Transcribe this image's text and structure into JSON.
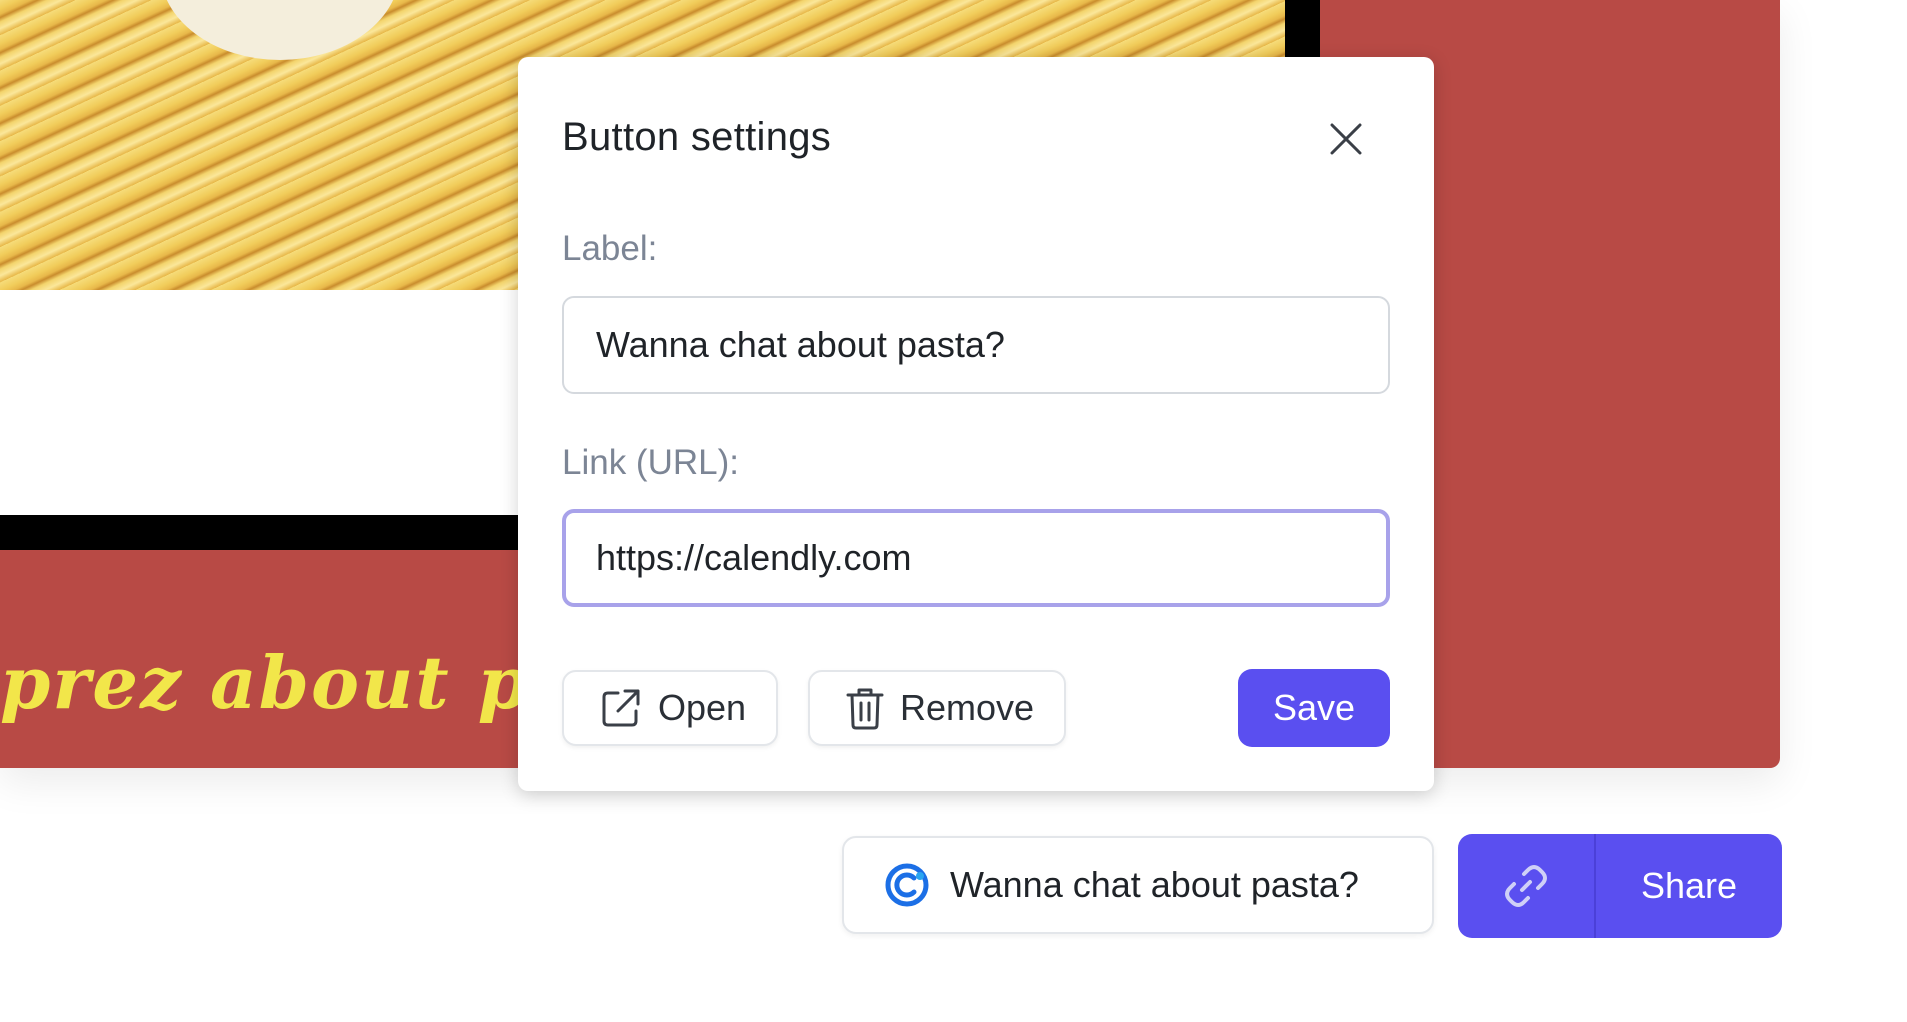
{
  "slide": {
    "text": "prez about p"
  },
  "modal": {
    "title": "Button settings",
    "label_field_label": "Label:",
    "label_value": "Wanna chat about pasta?",
    "link_field_label": "Link (URL):",
    "link_value": "https://calendly.com",
    "open_label": "Open",
    "remove_label": "Remove",
    "save_label": "Save"
  },
  "toolbar": {
    "cta_label": "Wanna chat about pasta?",
    "share_label": "Share"
  },
  "icons": {
    "close": "close-icon",
    "open": "external-link-icon",
    "remove": "trash-icon",
    "cta": "calendly-icon",
    "link": "link-icon"
  },
  "colors": {
    "accent": "#5a4ff0",
    "slide_background": "#b84a45",
    "slide_text": "#f2e64a",
    "focus_ring": "#a8a2ea"
  }
}
